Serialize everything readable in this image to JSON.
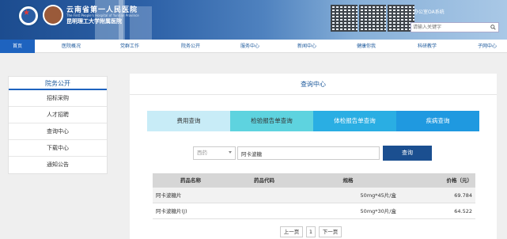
{
  "header": {
    "hospital_cn": "云南省第一人民医院",
    "hospital_en": "The First People's Hospital of Yunnan Province",
    "hospital_sub": "昆明理工大学附属医院",
    "oa_label": "办公室OA系统",
    "search_placeholder": "请输入关键字"
  },
  "nav": {
    "items": [
      {
        "label": "首页"
      },
      {
        "label": "医院概况"
      },
      {
        "label": "党群工作"
      },
      {
        "label": "院务公开"
      },
      {
        "label": "服务中心"
      },
      {
        "label": "新闻中心"
      },
      {
        "label": "健康你我"
      },
      {
        "label": "科研教学"
      },
      {
        "label": "子网中心"
      }
    ]
  },
  "sidebar": {
    "title": "院务公开",
    "items": [
      {
        "label": "招标采购"
      },
      {
        "label": "人才招聘"
      },
      {
        "label": "查询中心"
      },
      {
        "label": "下载中心"
      },
      {
        "label": "通知公告"
      }
    ]
  },
  "main": {
    "title": "查询中心",
    "tabs": [
      {
        "label": "费用查询"
      },
      {
        "label": "检验报告单查询"
      },
      {
        "label": "体检报告单查询"
      },
      {
        "label": "疾病查询"
      }
    ],
    "select_value": "西药",
    "input_value": "阿卡波糖",
    "query_button": "查询",
    "table": {
      "headers": [
        "药品名称",
        "药品代码",
        "规格",
        "价格（元）"
      ],
      "rows": [
        {
          "name": "阿卡波糖片",
          "code": "",
          "spec": "50mg*45片/盒",
          "price": "69.784"
        },
        {
          "name": "阿卡波糖片(J)",
          "code": "",
          "spec": "50mg*30片/盒",
          "price": "64.522"
        }
      ]
    },
    "pager": {
      "prev": "上一页",
      "page": "1",
      "next": "下一页"
    }
  },
  "colors": {
    "nav_active": "#1e63bf",
    "query_button": "#1b4f90",
    "tab1": "#c8ecf7",
    "tab2": "#5ed3df",
    "tab3": "#2aaee3",
    "tab4": "#1f99e0"
  }
}
